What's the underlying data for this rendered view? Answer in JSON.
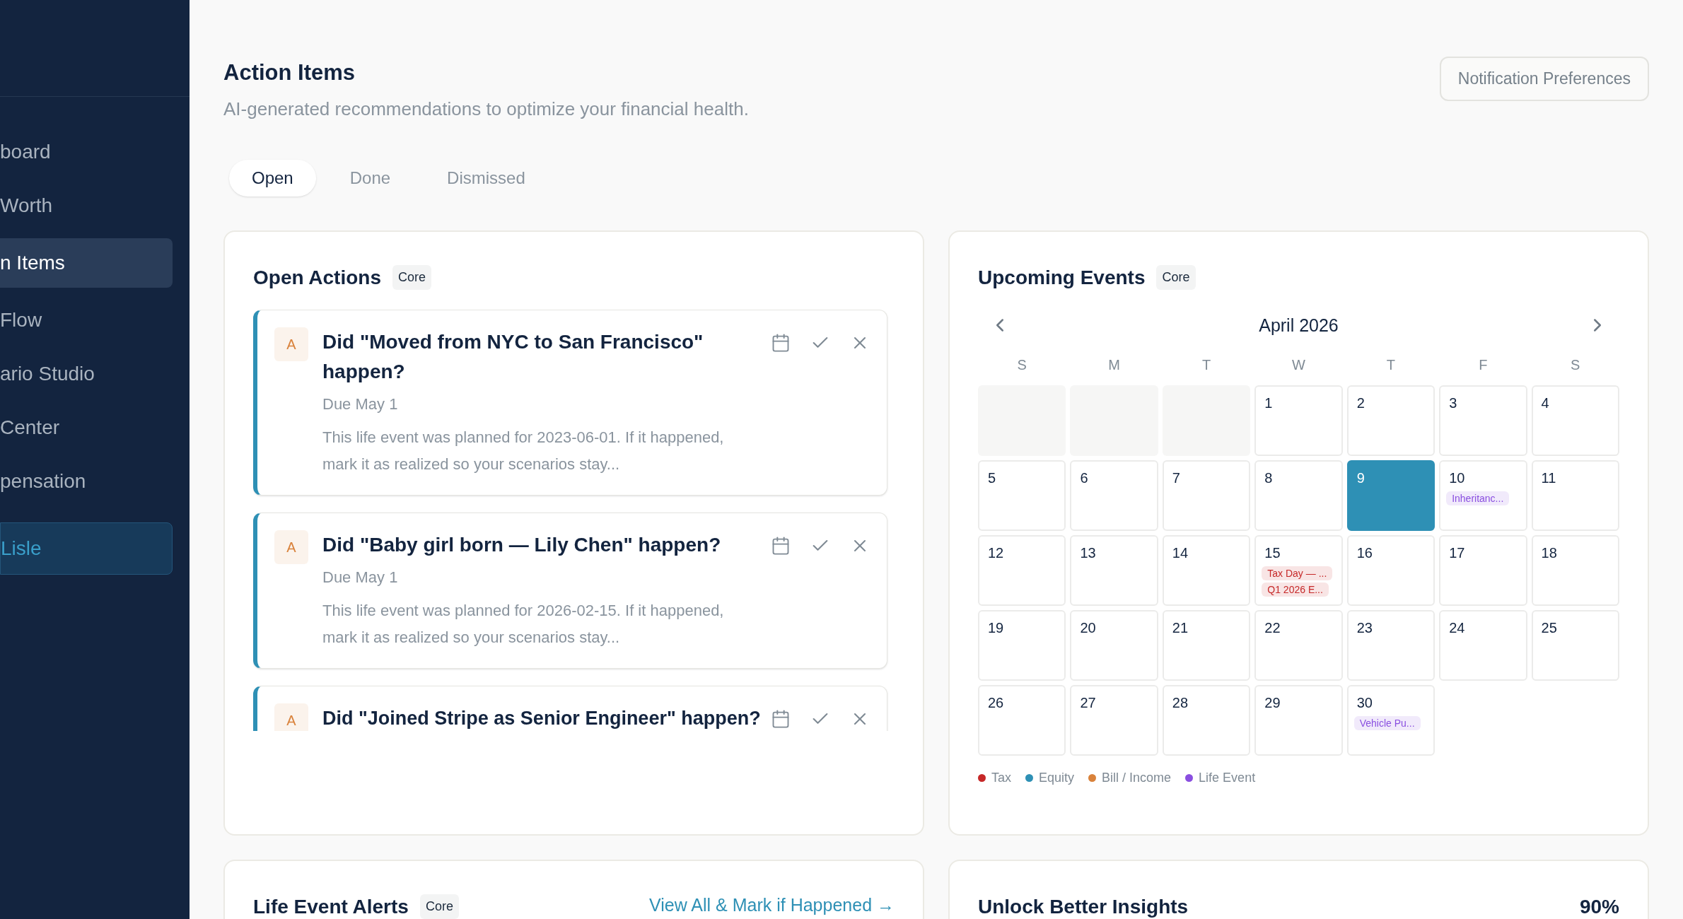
{
  "sidebar": {
    "items": [
      {
        "label": "board",
        "selected": false
      },
      {
        "label": "Worth",
        "selected": false
      },
      {
        "label": "n Items",
        "selected": true
      },
      {
        "label": "Flow",
        "selected": false
      },
      {
        "label": "ario Studio",
        "selected": false
      },
      {
        "label": "Center",
        "selected": false
      },
      {
        "label": "pensation",
        "selected": false
      }
    ],
    "account": {
      "label": "Lisle"
    }
  },
  "header": {
    "title": "Action Items",
    "subtitle": "AI-generated recommendations to optimize your financial health.",
    "button": "Notification Preferences"
  },
  "tabs": [
    {
      "label": "Open",
      "selected": true
    },
    {
      "label": "Done",
      "selected": false
    },
    {
      "label": "Dismissed",
      "selected": false
    }
  ],
  "open_actions": {
    "title": "Open Actions",
    "badge": "Core",
    "items": [
      {
        "avatar": "A",
        "title": "Did \"Moved from NYC to San Francisco\" happen?",
        "due": "Due May 1",
        "description": "This life event was planned for 2023-06-01. If it happened, mark it as realized so your scenarios stay..."
      },
      {
        "avatar": "A",
        "title": "Did \"Baby girl born — Lily Chen\" happen?",
        "due": "Due May 1",
        "description": "This life event was planned for 2026-02-15. If it happened, mark it as realized so your scenarios stay..."
      },
      {
        "avatar": "A",
        "title": "Did \"Joined Stripe as Senior Engineer\" happen?"
      }
    ]
  },
  "upcoming_events": {
    "title": "Upcoming Events",
    "badge": "Core",
    "month": "April 2026",
    "weekdays": [
      "S",
      "M",
      "T",
      "W",
      "T",
      "F",
      "S"
    ],
    "days": [
      {
        "kind": "blank"
      },
      {
        "kind": "blank"
      },
      {
        "kind": "blank"
      },
      {
        "kind": "day",
        "day": "1",
        "selected": false
      },
      {
        "kind": "day",
        "day": "2",
        "selected": false
      },
      {
        "kind": "day",
        "day": "3",
        "selected": false
      },
      {
        "kind": "day",
        "day": "4",
        "selected": false
      },
      {
        "kind": "day",
        "day": "5",
        "selected": false
      },
      {
        "kind": "day",
        "day": "6",
        "selected": false
      },
      {
        "kind": "day",
        "day": "7",
        "selected": false
      },
      {
        "kind": "day",
        "day": "8",
        "selected": false
      },
      {
        "kind": "day",
        "day": "9",
        "selected": true
      },
      {
        "kind": "day",
        "day": "10",
        "selected": false,
        "events": [
          {
            "label": "Inheritanc...",
            "color": "#8a4fe0"
          }
        ]
      },
      {
        "kind": "day",
        "day": "11",
        "selected": false
      },
      {
        "kind": "day",
        "day": "12",
        "selected": false
      },
      {
        "kind": "day",
        "day": "13",
        "selected": false
      },
      {
        "kind": "day",
        "day": "14",
        "selected": false
      },
      {
        "kind": "day",
        "day": "15",
        "selected": false,
        "events": [
          {
            "label": "Tax Day — ...",
            "color": "#c62828"
          },
          {
            "label": "Q1 2026 E...",
            "color": "#c62828"
          }
        ]
      },
      {
        "kind": "day",
        "day": "16",
        "selected": false
      },
      {
        "kind": "day",
        "day": "17",
        "selected": false
      },
      {
        "kind": "day",
        "day": "18",
        "selected": false
      },
      {
        "kind": "day",
        "day": "19",
        "selected": false
      },
      {
        "kind": "day",
        "day": "20",
        "selected": false
      },
      {
        "kind": "day",
        "day": "21",
        "selected": false
      },
      {
        "kind": "day",
        "day": "22",
        "selected": false
      },
      {
        "kind": "day",
        "day": "23",
        "selected": false
      },
      {
        "kind": "day",
        "day": "24",
        "selected": false
      },
      {
        "kind": "day",
        "day": "25",
        "selected": false
      },
      {
        "kind": "day",
        "day": "26",
        "selected": false
      },
      {
        "kind": "day",
        "day": "27",
        "selected": false
      },
      {
        "kind": "day",
        "day": "28",
        "selected": false
      },
      {
        "kind": "day",
        "day": "29",
        "selected": false
      },
      {
        "kind": "day",
        "day": "30",
        "selected": false,
        "events": [
          {
            "label": "Vehicle Pu...",
            "color": "#8a4fe0"
          }
        ]
      }
    ],
    "legend": [
      {
        "label": "Tax",
        "color": "#c62828"
      },
      {
        "label": "Equity",
        "color": "#2e90b5"
      },
      {
        "label": "Bill / Income",
        "color": "#d9823b"
      },
      {
        "label": "Life Event",
        "color": "#8a4fe0"
      }
    ]
  },
  "life_event_alerts": {
    "title": "Life Event Alerts",
    "badge": "Core",
    "link": "View All & Mark if Happened →"
  },
  "insights": {
    "title": "Unlock Better Insights",
    "value": "90%"
  }
}
